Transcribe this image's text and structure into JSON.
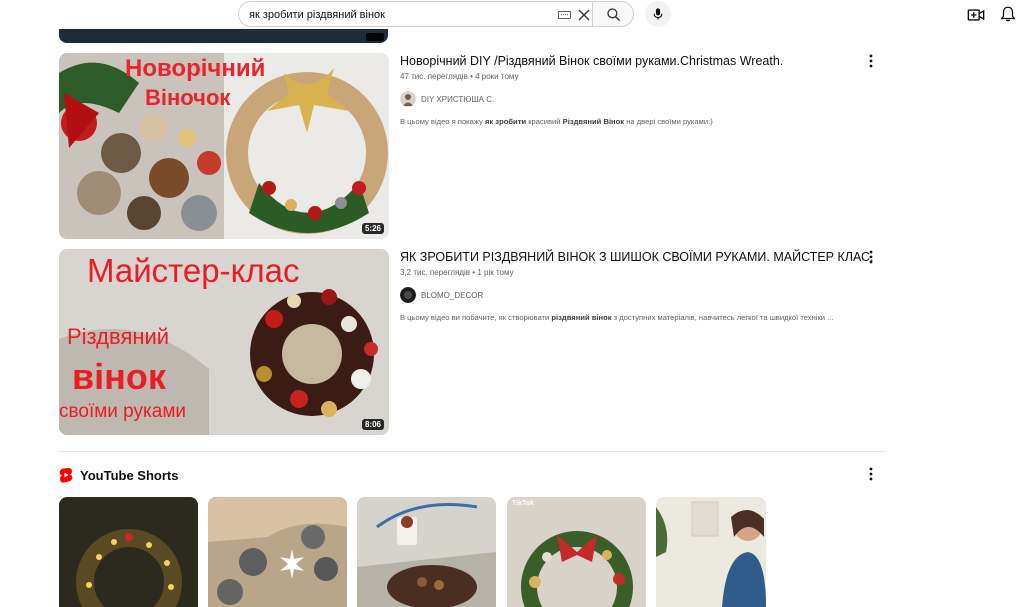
{
  "search": {
    "query": "як зробити різдвяний вінок"
  },
  "videos": [
    {
      "title": "Новорічний DIY /Різдвяний Вінок своїми руками.Christmas Wreath.",
      "views": "47 тис. переглядів",
      "age": "4 роки тому",
      "channel": "DIY ХРИСТЮША С.",
      "desc_pre": "В цьому відео я покажу ",
      "desc_b1": "як зробити",
      "desc_mid": " красивий ",
      "desc_b2": "Різдвяний Вінок",
      "desc_post": " на двері своїми руками:)",
      "duration": "5:26",
      "thumb_text_1": "Новорічний",
      "thumb_text_2": "Віночок"
    },
    {
      "title": "ЯК ЗРОБИТИ РІЗДВЯНИЙ ВІНОК З ШИШОК СВОЇМИ РУКАМИ. МАЙСТЕР КЛАС.",
      "views": "3,2 тис. переглядів",
      "age": "1 рік тому",
      "channel": "BLOMO_DECOR",
      "desc_pre": "В цьому відео ви побачите, як створювати ",
      "desc_b1": "різдвяний вінок",
      "desc_mid": " з доступних матеріалів, навчитесь легкої та швидкої техніки ...",
      "desc_b2": "",
      "desc_post": "",
      "duration": "8:06",
      "thumb_text_1": "Майстер-клас",
      "thumb_text_2": "Різдвяний",
      "thumb_text_3": "вінок",
      "thumb_text_4": "своїми руками"
    }
  ],
  "meta_separator": "•",
  "shorts": {
    "title": "YouTube Shorts",
    "items": [
      {
        "overlay": "",
        "tone": "#2b2a1c"
      },
      {
        "overlay": "",
        "tone": "#b9a58a"
      },
      {
        "overlay": "",
        "tone": "#8e8c87"
      },
      {
        "overlay": "TikTok",
        "tone": "#d9d2c8"
      },
      {
        "overlay": "",
        "tone": "#e9e6de"
      }
    ]
  },
  "colors": {
    "brand_red": "#ff0000",
    "text_primary": "#0f0f0f",
    "text_secondary": "#606060"
  }
}
